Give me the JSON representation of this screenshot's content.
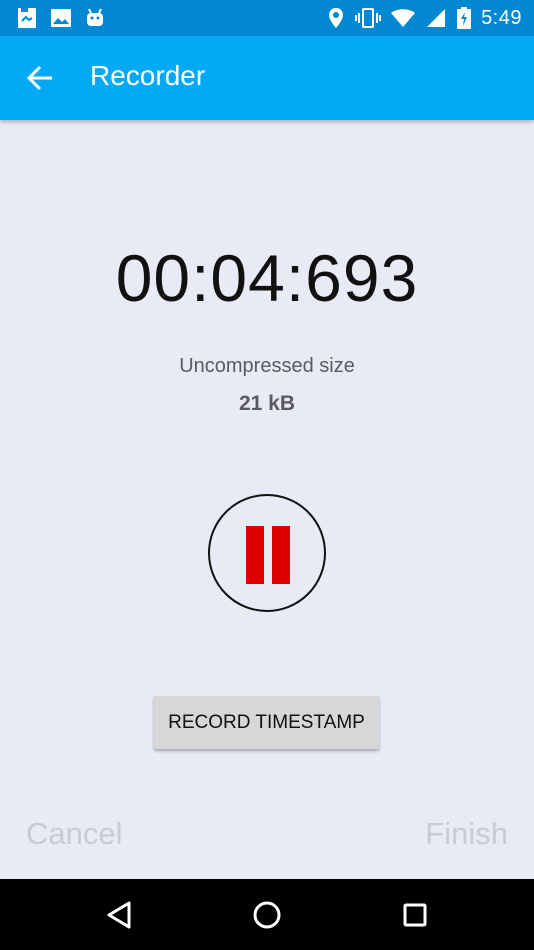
{
  "status_bar": {
    "time": "5:49",
    "left_icons": [
      "file-icon",
      "image-icon",
      "android-icon"
    ],
    "right_icons": [
      "location-icon",
      "vibrate-icon",
      "wifi-icon",
      "signal-icon",
      "battery-charging-icon"
    ]
  },
  "app_bar": {
    "title": "Recorder",
    "background": "#03a9f4",
    "status_background": "#0288d1"
  },
  "recorder": {
    "elapsed_time": "00:04:693",
    "size_label": "Uncompressed size",
    "size_value": "21 kB",
    "pause_color": "#dd0000"
  },
  "actions": {
    "timestamp_label": "RECORD TIMESTAMP",
    "cancel_label": "Cancel",
    "finish_label": "Finish"
  },
  "navigation": {
    "buttons": [
      "nav-back-icon",
      "nav-home-icon",
      "nav-recents-icon"
    ]
  }
}
